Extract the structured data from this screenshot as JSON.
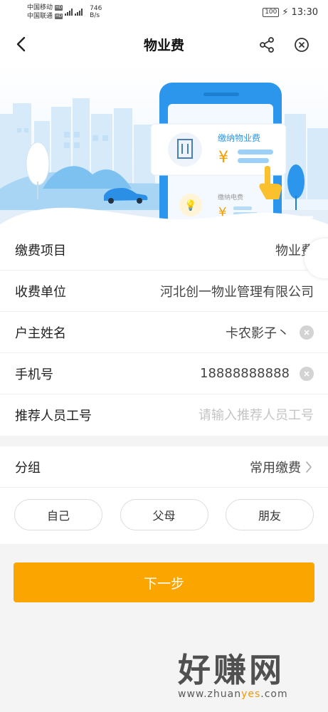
{
  "status_bar": {
    "carrier1": "中国移动",
    "carrier2": "中国联通",
    "hd": "HD",
    "net_type": "4G",
    "net_speed": "746",
    "net_speed_unit": "B/s",
    "battery": "100",
    "time": "13:30"
  },
  "nav": {
    "title": "物业费"
  },
  "banner": {
    "card_title": "缴纳物业费",
    "card_title2": "缴纳电费",
    "currency": "¥"
  },
  "form": {
    "rows": [
      {
        "label": "缴费项目",
        "value": "物业费"
      },
      {
        "label": "收费单位",
        "value": "河北创一物业管理有限公司"
      },
      {
        "label": "户主姓名",
        "value": "卡农影子丶"
      },
      {
        "label": "手机号",
        "value": "18888888888"
      },
      {
        "label": "推荐人员工号",
        "placeholder": "请输入推荐人员工号"
      }
    ]
  },
  "group": {
    "label": "分组",
    "value": "常用缴费",
    "chips": [
      "自己",
      "父母",
      "朋友"
    ]
  },
  "next_button": "下一步",
  "watermark": {
    "text": "好赚网",
    "url_prefix": "www.zhuan",
    "url_accent": "yes",
    "url_suffix": ".com"
  },
  "colors": {
    "accent": "#fba600",
    "banner_blue": "#3ba4f5"
  }
}
